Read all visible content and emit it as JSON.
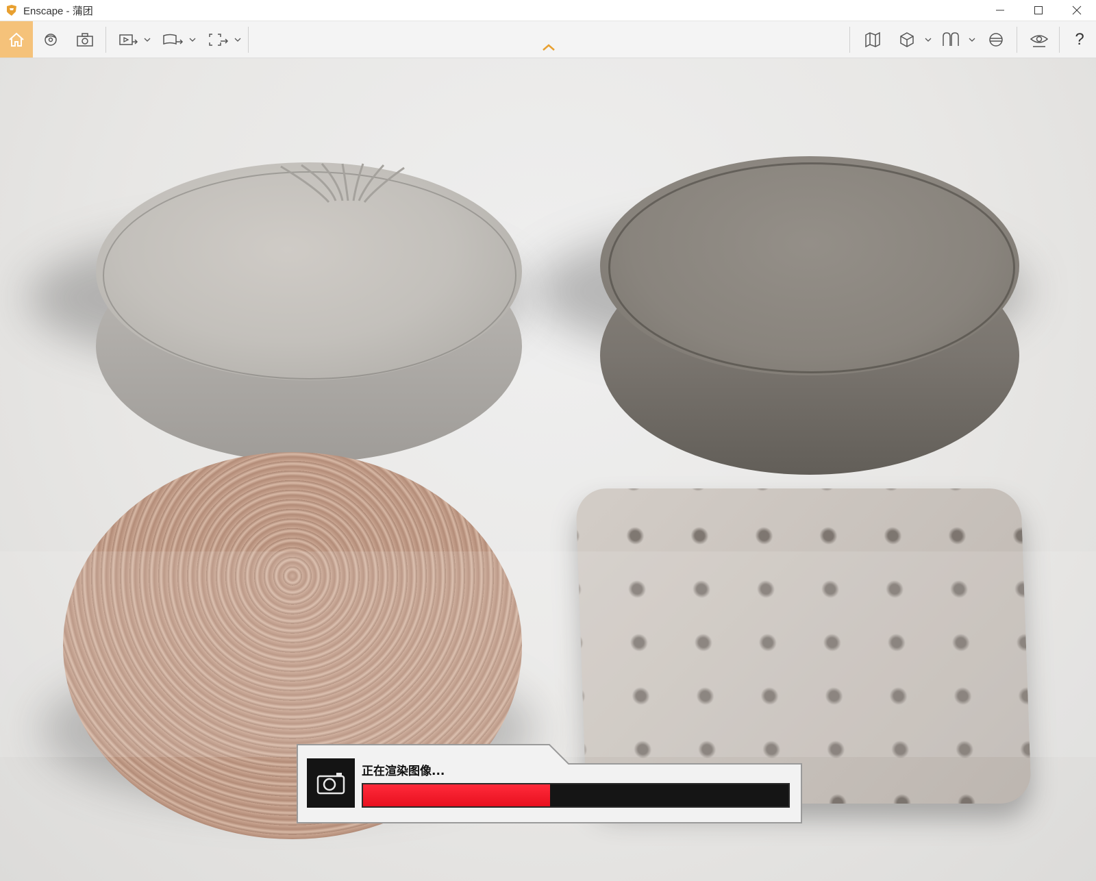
{
  "window": {
    "app_name": "Enscape",
    "separator": " - ",
    "document": "蒲团"
  },
  "toolbar": {
    "left_icons": [
      "home-icon",
      "orbit-icon",
      "screenshot-icon",
      "export-video-icon",
      "export-panorama-icon",
      "batch-render-icon"
    ],
    "right_icons": [
      "map-icon",
      "cube-icon",
      "library-icon",
      "atmosphere-icon",
      "visual-settings-icon",
      "help-icon"
    ],
    "help_label": "?",
    "accent_color": "#f5c27a",
    "collapse_color": "#e8a030"
  },
  "render": {
    "status_text": "正在渲染图像...",
    "progress": 0.44,
    "progress_color": "#e8101f"
  }
}
